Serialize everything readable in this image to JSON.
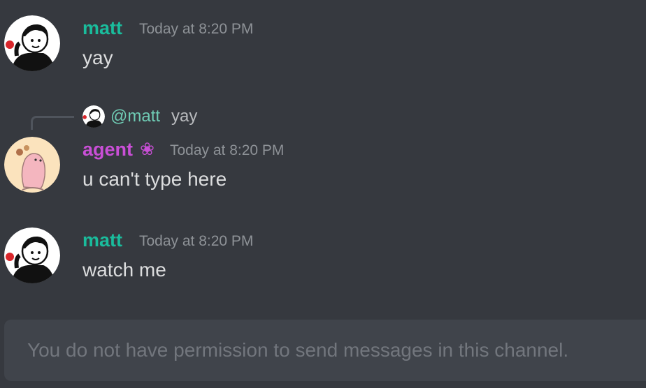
{
  "colors": {
    "background": "#36393f",
    "matt": "#1abc9c",
    "agent": "#c94fd6",
    "mention": "#6fcbb4",
    "timestamp": "#8e9297",
    "text": "#dcddde",
    "composer_bg": "#40444b",
    "composer_text": "#72767d"
  },
  "messages": [
    {
      "username": "matt",
      "timestamp": "Today at 8:20 PM",
      "content": "yay",
      "avatar": "avatar-matt"
    },
    {
      "reply": {
        "mention": "@matt",
        "text": "yay",
        "avatar": "avatar-matt"
      },
      "username": "agent",
      "badge": "❀",
      "timestamp": "Today at 8:20 PM",
      "content": "u can't type here",
      "avatar": "avatar-agent"
    },
    {
      "username": "matt",
      "timestamp": "Today at 8:20 PM",
      "content": "watch me",
      "avatar": "avatar-matt"
    }
  ],
  "composer": {
    "placeholder": "You do not have permission to send messages in this channel."
  }
}
